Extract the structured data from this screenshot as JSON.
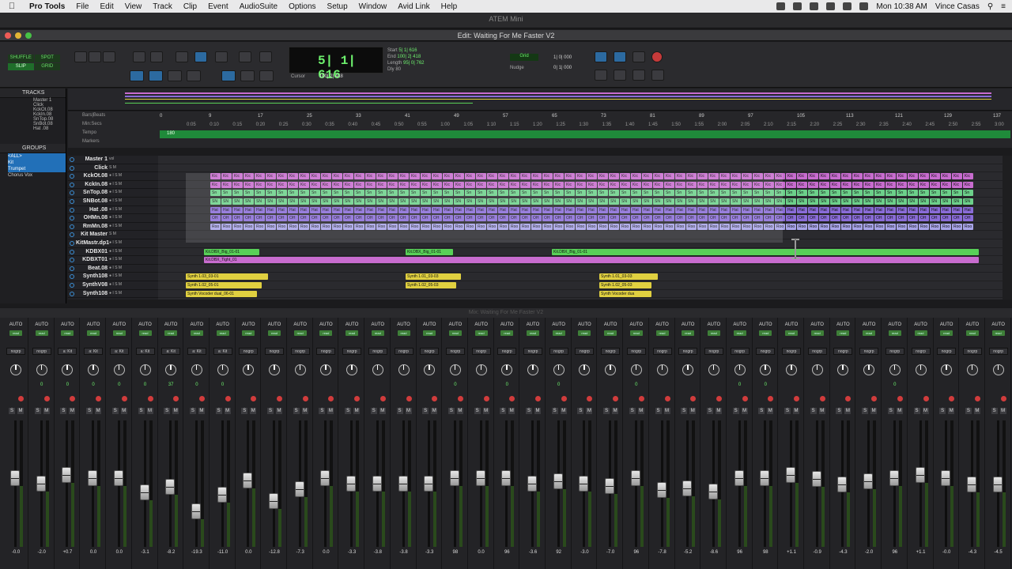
{
  "menubar": {
    "app": "Pro Tools",
    "items": [
      "File",
      "Edit",
      "View",
      "Track",
      "Clip",
      "Event",
      "AudioSuite",
      "Options",
      "Setup",
      "Window",
      "Avid Link",
      "Help"
    ],
    "clock": "Mon 10:38 AM",
    "user": "Vince Casas"
  },
  "atem_title": "ATEM Mini",
  "edit_window": {
    "title": "Edit: Waiting For Me Faster V2",
    "edit_modes": [
      {
        "label": "SHUFFLE",
        "active": false
      },
      {
        "label": "SPOT",
        "active": false
      },
      {
        "label": "SLIP",
        "active": true
      },
      {
        "label": "GRID",
        "active": false
      }
    ],
    "zoom_presets": [
      "1",
      "2",
      "3",
      "4",
      "5"
    ],
    "counter": {
      "main": "5| 1| 616",
      "labels": {
        "start": "Start",
        "end": "End",
        "length": "Length",
        "cursor": "Cursor"
      },
      "start": "5| 1| 616",
      "end": "100| 2| 418",
      "length": "95| 0| 762",
      "cursor": "100| 2| 418",
      "dly": "Dly",
      "preroll": "80"
    },
    "grid": {
      "label": "Grid",
      "value": "1| 0| 000"
    },
    "nudge": {
      "label": "Nudge",
      "value": "0| 1| 000"
    }
  },
  "tracks_panel": {
    "title": "TRACKS",
    "items": [
      "Master 1",
      "Click",
      "KckOt.08",
      "KckIn.08",
      "SnTop.08",
      "SnBot.08",
      "Hat .08"
    ]
  },
  "groups_panel": {
    "title": "GROUPS",
    "items": [
      "<ALL>",
      "Kit",
      "Trumpet",
      "Chorus Vox"
    ],
    "highlighted": [
      true,
      true,
      true,
      false
    ]
  },
  "ruler": {
    "labels": [
      "Bars|Beats",
      "Min:Secs",
      "Tempo",
      "Markers"
    ],
    "bars": [
      "0",
      "9",
      "17",
      "25",
      "33",
      "41",
      "49",
      "57",
      "65",
      "73",
      "81",
      "89",
      "97",
      "105",
      "113",
      "121",
      "129",
      "137"
    ],
    "mins": [
      "0:05",
      "0:10",
      "0:15",
      "0:20",
      "0:25",
      "0:30",
      "0:35",
      "0:40",
      "0:45",
      "0:50",
      "0:55",
      "1:00",
      "1:05",
      "1:10",
      "1:15",
      "1:20",
      "1:25",
      "1:30",
      "1:35",
      "1:40",
      "1:45",
      "1:50",
      "1:55",
      "2:00",
      "2:05",
      "2:10",
      "2:15",
      "2:20",
      "2:25",
      "2:30",
      "2:35",
      "2:40",
      "2:45",
      "2:50",
      "2:55",
      "3:00"
    ],
    "tempo": "180"
  },
  "tracks": [
    {
      "name": "Master 1",
      "btns": "vol"
    },
    {
      "name": "Click",
      "btns": "S M"
    },
    {
      "name": "KckOt.08",
      "btns": "● I S M"
    },
    {
      "name": "KckIn.08",
      "btns": "● I S M"
    },
    {
      "name": "SnTop.08",
      "btns": "● I S M"
    },
    {
      "name": "SNBot.08",
      "btns": "● I S M"
    },
    {
      "name": "Hat .08",
      "btns": "● I S M"
    },
    {
      "name": "OHMn.08",
      "btns": "● I S M"
    },
    {
      "name": "RmMn.08",
      "btns": "● I S M"
    },
    {
      "name": "Kit Master",
      "btns": "S M"
    },
    {
      "name": "KitMastr.dp1",
      "btns": "● I S M"
    },
    {
      "name": "KDBX01",
      "btns": "● I S M"
    },
    {
      "name": "KDBXT01",
      "btns": "● I S M"
    },
    {
      "name": "Beat.08",
      "btns": "● I S M"
    },
    {
      "name": "Synth108",
      "btns": "● I S M"
    },
    {
      "name": "SynthV08",
      "btns": "● I S M"
    },
    {
      "name": "Synth108",
      "btns": "● I S M"
    }
  ],
  "clips": {
    "kick": "Kic",
    "snare_top": "Sn",
    "snare_bot": "SN",
    "hat": "Hat",
    "oh": "OH",
    "room": "Roo",
    "kdbx1": "Kit.DBX_Big_01-01",
    "kdbx2": "Kit.DBX_Big_01-01",
    "kdbx3": "Kit.DBX_Big_01-01",
    "kdbxt": "Kit.DBX_Tight_01",
    "synth1": "Synth 1.03_03-01",
    "synth2": "Synth 1.02_05-01",
    "synth3": "Synth Vocoder dual_06-01",
    "synth4": "Synth 1.01_03-03",
    "synth5": "Synth 1.02_05-03",
    "synth6": "Synth 1.01_03-03",
    "synth7": "Synth 1.02_05-03",
    "synth8": "Synth Vocoder dua"
  },
  "mix_window": {
    "title": "Mix: Waiting For Me Faster V2",
    "strips": [
      {
        "auto": "AUTO",
        "read": "read",
        "group": "nogrp",
        "pan": "",
        "vol": "-0.0",
        "fader": 0.55
      },
      {
        "auto": "AUTO",
        "read": "read",
        "group": "nogrp",
        "pan": "0",
        "vol": "-2.0",
        "fader": 0.5
      },
      {
        "auto": "AUTO",
        "read": "read",
        "group": "a: Kit",
        "pan": "0",
        "vol": "+0.7",
        "fader": 0.58
      },
      {
        "auto": "AUTO",
        "read": "read",
        "group": "a: Kit",
        "pan": "0",
        "vol": "0.0",
        "fader": 0.55
      },
      {
        "auto": "AUTO",
        "read": "read",
        "group": "a: Kit",
        "pan": "0",
        "vol": "0.0",
        "fader": 0.55
      },
      {
        "auto": "AUTO",
        "read": "read",
        "group": "a: Kit",
        "pan": "0",
        "vol": "-3.1",
        "fader": 0.42
      },
      {
        "auto": "AUTO",
        "read": "read",
        "group": "a: Kit",
        "pan": "37",
        "vol": "-8.2",
        "fader": 0.47
      },
      {
        "auto": "AUTO",
        "read": "read",
        "group": "a: Kit",
        "pan": "0",
        "vol": "-19.3",
        "fader": 0.25
      },
      {
        "auto": "AUTO",
        "read": "read",
        "group": "a: Kit",
        "pan": "0",
        "vol": "-11.0",
        "fader": 0.4
      },
      {
        "auto": "AUTO",
        "read": "read",
        "group": "nogrp",
        "pan": "",
        "vol": "0.0",
        "fader": 0.53
      },
      {
        "auto": "AUTO",
        "read": "read",
        "group": "nogrp",
        "pan": "",
        "vol": "-12.8",
        "fader": 0.34
      },
      {
        "auto": "AUTO",
        "read": "read",
        "group": "nogrp",
        "pan": "",
        "vol": "-7.3",
        "fader": 0.45
      },
      {
        "auto": "AUTO",
        "read": "read",
        "group": "nogrp",
        "pan": "",
        "vol": "0.0",
        "fader": 0.55
      },
      {
        "auto": "AUTO",
        "read": "read",
        "group": "nogrp",
        "pan": "",
        "vol": "-3.3",
        "fader": 0.5
      },
      {
        "auto": "AUTO",
        "read": "read",
        "group": "nogrp",
        "pan": "",
        "vol": "-3.8",
        "fader": 0.5
      },
      {
        "auto": "AUTO",
        "read": "read",
        "group": "nogrp",
        "pan": "",
        "vol": "-3.8",
        "fader": 0.5
      },
      {
        "auto": "AUTO",
        "read": "read",
        "group": "nogrp",
        "pan": "",
        "vol": "-3.3",
        "fader": 0.5
      },
      {
        "auto": "AUTO",
        "read": "read",
        "group": "nogrp",
        "pan": "0",
        "vol": "98",
        "fader": 0.55
      },
      {
        "auto": "AUTO",
        "read": "read",
        "group": "nogrp",
        "pan": "",
        "vol": "0.0",
        "fader": 0.55
      },
      {
        "auto": "AUTO",
        "read": "read",
        "group": "nogrp",
        "pan": "0",
        "vol": "96",
        "fader": 0.55
      },
      {
        "auto": "AUTO",
        "read": "read",
        "group": "nogrp",
        "pan": "",
        "vol": "-3.6",
        "fader": 0.5
      },
      {
        "auto": "AUTO",
        "read": "read",
        "group": "nogrp",
        "pan": "0",
        "vol": "92",
        "fader": 0.52
      },
      {
        "auto": "AUTO",
        "read": "read",
        "group": "nogrp",
        "pan": "",
        "vol": "-3.0",
        "fader": 0.5
      },
      {
        "auto": "AUTO",
        "read": "read",
        "group": "nogrp",
        "pan": "",
        "vol": "-7.0",
        "fader": 0.48
      },
      {
        "auto": "AUTO",
        "read": "read",
        "group": "nogrp",
        "pan": "0",
        "vol": "96",
        "fader": 0.55
      },
      {
        "auto": "AUTO",
        "read": "read",
        "group": "nogrp",
        "pan": "",
        "vol": "-7.8",
        "fader": 0.44
      },
      {
        "auto": "AUTO",
        "read": "read",
        "group": "nogrp",
        "pan": "",
        "vol": "-5.2",
        "fader": 0.46
      },
      {
        "auto": "AUTO",
        "read": "read",
        "group": "nogrp",
        "pan": "",
        "vol": "-8.6",
        "fader": 0.43
      },
      {
        "auto": "AUTO",
        "read": "read",
        "group": "nogrp",
        "pan": "0",
        "vol": "96",
        "fader": 0.55
      },
      {
        "auto": "AUTO",
        "read": "read",
        "group": "nogrp",
        "pan": "0",
        "vol": "98",
        "fader": 0.55
      },
      {
        "auto": "AUTO",
        "read": "read",
        "group": "nogrp",
        "pan": "",
        "vol": "+1.1",
        "fader": 0.58
      },
      {
        "auto": "AUTO",
        "read": "read",
        "group": "nogrp",
        "pan": "",
        "vol": "-0.9",
        "fader": 0.54
      },
      {
        "auto": "AUTO",
        "read": "read",
        "group": "nogrp",
        "pan": "",
        "vol": "-4.3",
        "fader": 0.49
      },
      {
        "auto": "AUTO",
        "read": "read",
        "group": "nogrp",
        "pan": "",
        "vol": "-2.0",
        "fader": 0.52
      },
      {
        "auto": "AUTO",
        "read": "read",
        "group": "nogrp",
        "pan": "0",
        "vol": "96",
        "fader": 0.55
      },
      {
        "auto": "AUTO",
        "read": "read",
        "group": "nogrp",
        "pan": "",
        "vol": "+1.1",
        "fader": 0.58
      },
      {
        "auto": "AUTO",
        "read": "read",
        "group": "nogrp",
        "pan": "",
        "vol": "-0.0",
        "fader": 0.55
      },
      {
        "auto": "AUTO",
        "read": "read",
        "group": "nogrp",
        "pan": "",
        "vol": "-4.3",
        "fader": 0.49
      },
      {
        "auto": "AUTO",
        "read": "read",
        "group": "nogrp",
        "pan": "",
        "vol": "-4.5",
        "fader": 0.49
      }
    ]
  },
  "colors": {
    "tempo": "#1f8a3a",
    "kick": "#c86ccf",
    "snare": "#6cd08a",
    "hat": "#8a6cd8",
    "room": "#a8a4e8",
    "synth": "#e0d040",
    "kdbx": "#58d058",
    "selection": "#2270b8"
  }
}
